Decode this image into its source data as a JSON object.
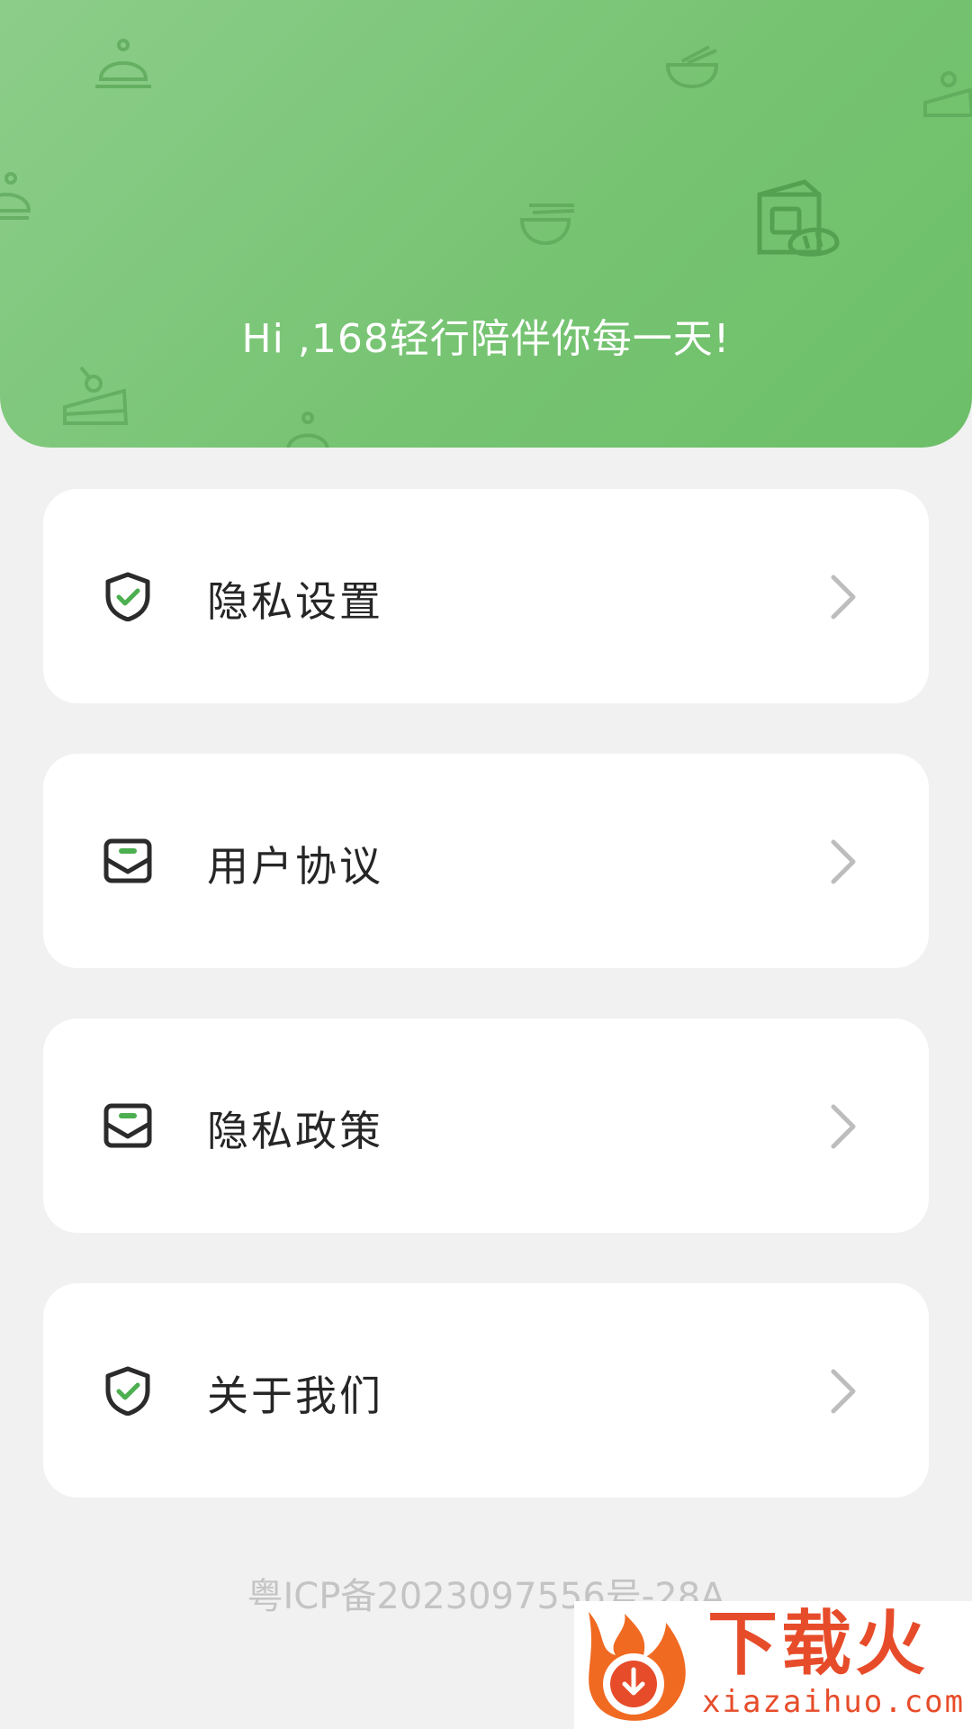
{
  "header": {
    "greeting": "Hi ,168轻行陪伴你每一天!"
  },
  "menu": [
    {
      "label": "隐私设置",
      "icon": "shield-check-icon"
    },
    {
      "label": "用户协议",
      "icon": "envelope-icon"
    },
    {
      "label": "隐私政策",
      "icon": "envelope-icon"
    },
    {
      "label": "关于我们",
      "icon": "shield-check-icon"
    }
  ],
  "footer": {
    "icp": "粤ICP备2023097556号-28A"
  },
  "watermark": {
    "title": "下载火",
    "site": "xiazaihuo.com"
  },
  "colors": {
    "accent": "#6cbf68",
    "icon_check": "#4caf50",
    "watermark": "#e74c2a"
  }
}
